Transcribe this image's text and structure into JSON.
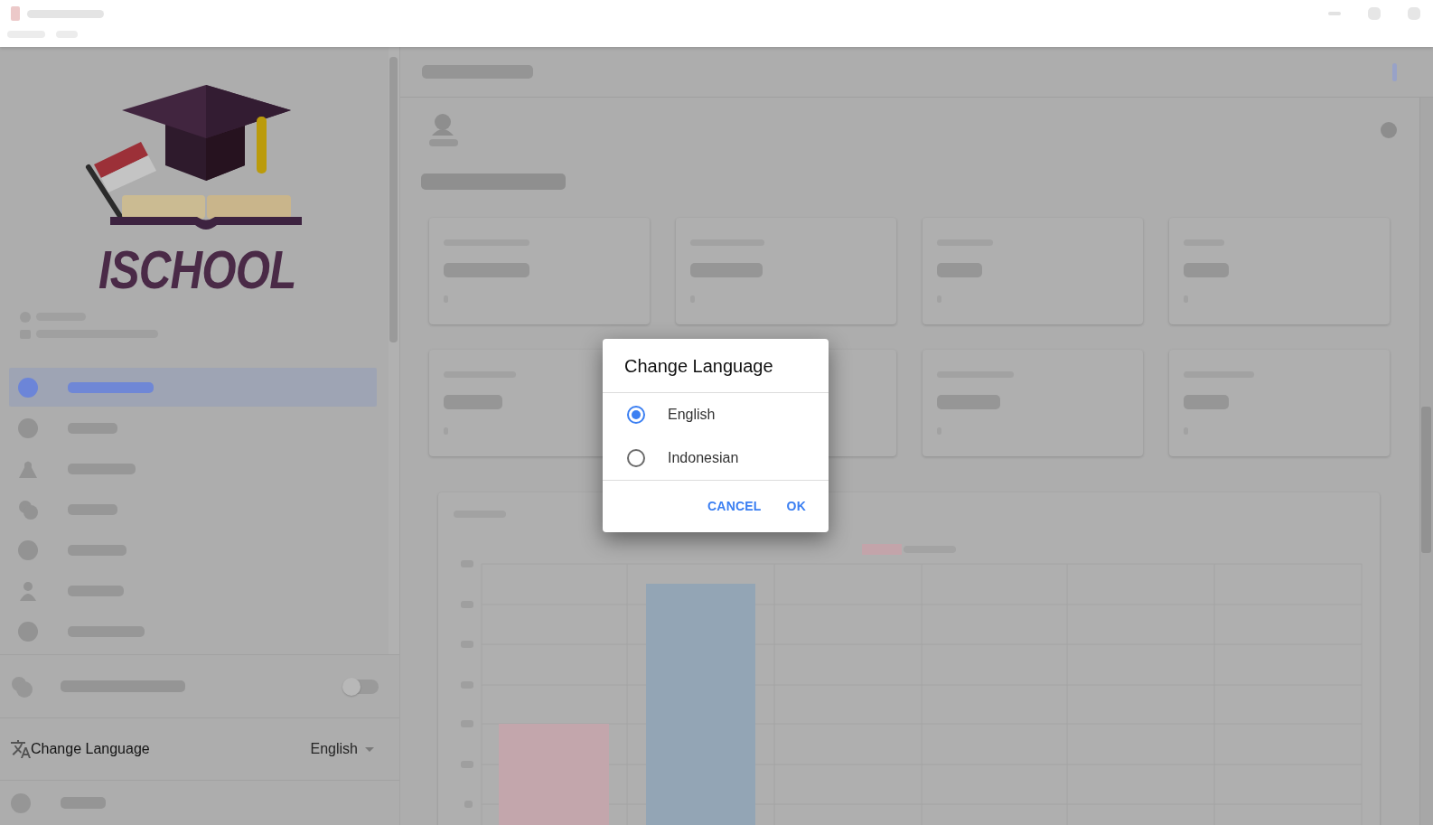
{
  "sidebar": {
    "logo": {
      "text": "ISCHOOL"
    },
    "nav_items": [
      {
        "selected": true
      },
      {
        "selected": false
      },
      {
        "selected": false
      },
      {
        "selected": false
      },
      {
        "selected": false
      },
      {
        "selected": false
      },
      {
        "selected": false
      }
    ],
    "theme_toggle": {
      "on": false
    },
    "language": {
      "label": "Change Language",
      "value": "English"
    }
  },
  "dialog": {
    "title": "Change Language",
    "options": [
      {
        "label": "English",
        "selected": true
      },
      {
        "label": "Indonesian",
        "selected": false
      }
    ],
    "buttons": [
      "CANCEL",
      "OK"
    ]
  }
}
